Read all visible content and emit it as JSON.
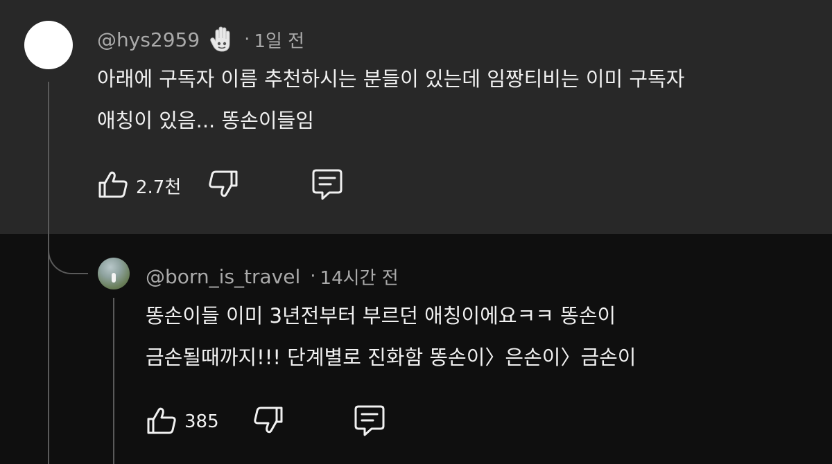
{
  "comment": {
    "handle": "@hys2959",
    "badge_icon": "raised-hand-emoji-icon",
    "separator": "·",
    "time": "1일 전",
    "lines": [
      "아래에 구독자 이름 추천하시는 분들이 있는데 임짱티비는 이미 구독자",
      "애칭이 있음... 똥손이들임"
    ],
    "likes": "2.7천",
    "avatar_color": "#ffffff"
  },
  "reply": {
    "handle": "@born_is_travel",
    "separator": "·",
    "time": "14시간 전",
    "lines": [
      "똥손이들 이미 3년전부터 부르던 애칭이에요ㅋㅋ 똥손이",
      "금손될때까지!!! 단계별로 진화함 똥손이〉은손이〉금손이"
    ],
    "likes": "385"
  },
  "icons": {
    "like": "thumbs-up-icon",
    "dislike": "thumbs-down-icon",
    "reply": "comment-icon"
  },
  "colors": {
    "top_background": "#282828",
    "bottom_background": "#0f0f0f",
    "text": "#f1f1f1",
    "secondary_text": "#aaaaaa"
  }
}
